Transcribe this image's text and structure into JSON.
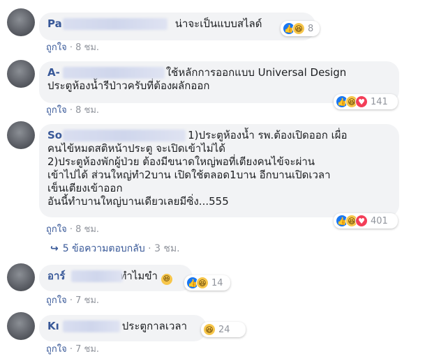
{
  "comments": [
    {
      "name": "Pa",
      "text": "น่าจะเป็นแบบสไลด์",
      "reaction_count": "8",
      "like_label": "ถูกใจ",
      "time": "8 ชม."
    },
    {
      "name": "A-",
      "text": "ใช้หลักการออกแบบ Universal Design\nประตูห้องน้ำรีป่าวครับที่ต้องผลักออก",
      "reaction_count": "141",
      "like_label": "ถูกใจ",
      "time": "8 ชม."
    },
    {
      "name": "So",
      "text_line1": "1)ประตูห้องน้ำ รพ.ต้องเปิดออก เผื่อ",
      "text_rest": "คนไข้หมดสติหน้าประตู จะเปิดเข้าไม่ได้\n2)ประตูห้องพักผู้ป่วย ต้องมีขนาดใหญ่พอที่เตียงคนไข้จะผ่าน\nเข้าไปได้ ส่วนใหญ่ทำ2บาน เปิดใช้ตลอด1บาน อีกบานเปิดเวลา\nเข็นเตียงเข้าออก\nอันนี้ทำบานใหญ่บานเดียวเลยมีซิ่ง...555",
      "reaction_count": "401",
      "like_label": "ถูกใจ",
      "time": "8 ชม.",
      "replies_label": "5 ข้อความตอบกลับ",
      "replies_time": "3 ชม."
    },
    {
      "name": "อาร์",
      "text": "ทำไมขำ",
      "reaction_count": "14",
      "like_label": "ถูกใจ",
      "time": "7 ชม."
    },
    {
      "name": "Kı",
      "text": "ประตูกาลเวลา",
      "reaction_count": "24",
      "like_label": "ถูกใจ",
      "time": "7 ชม."
    }
  ],
  "colors": {
    "name": "#385898",
    "bubble": "#f2f3f5",
    "meta": "#90949c",
    "like": "#1877f2",
    "haha": "#f7c64a",
    "love": "#f33e58"
  },
  "icons": [
    "like-icon",
    "haha-icon",
    "love-icon",
    "reply-arrow-icon",
    "laughing-emoji-icon"
  ]
}
